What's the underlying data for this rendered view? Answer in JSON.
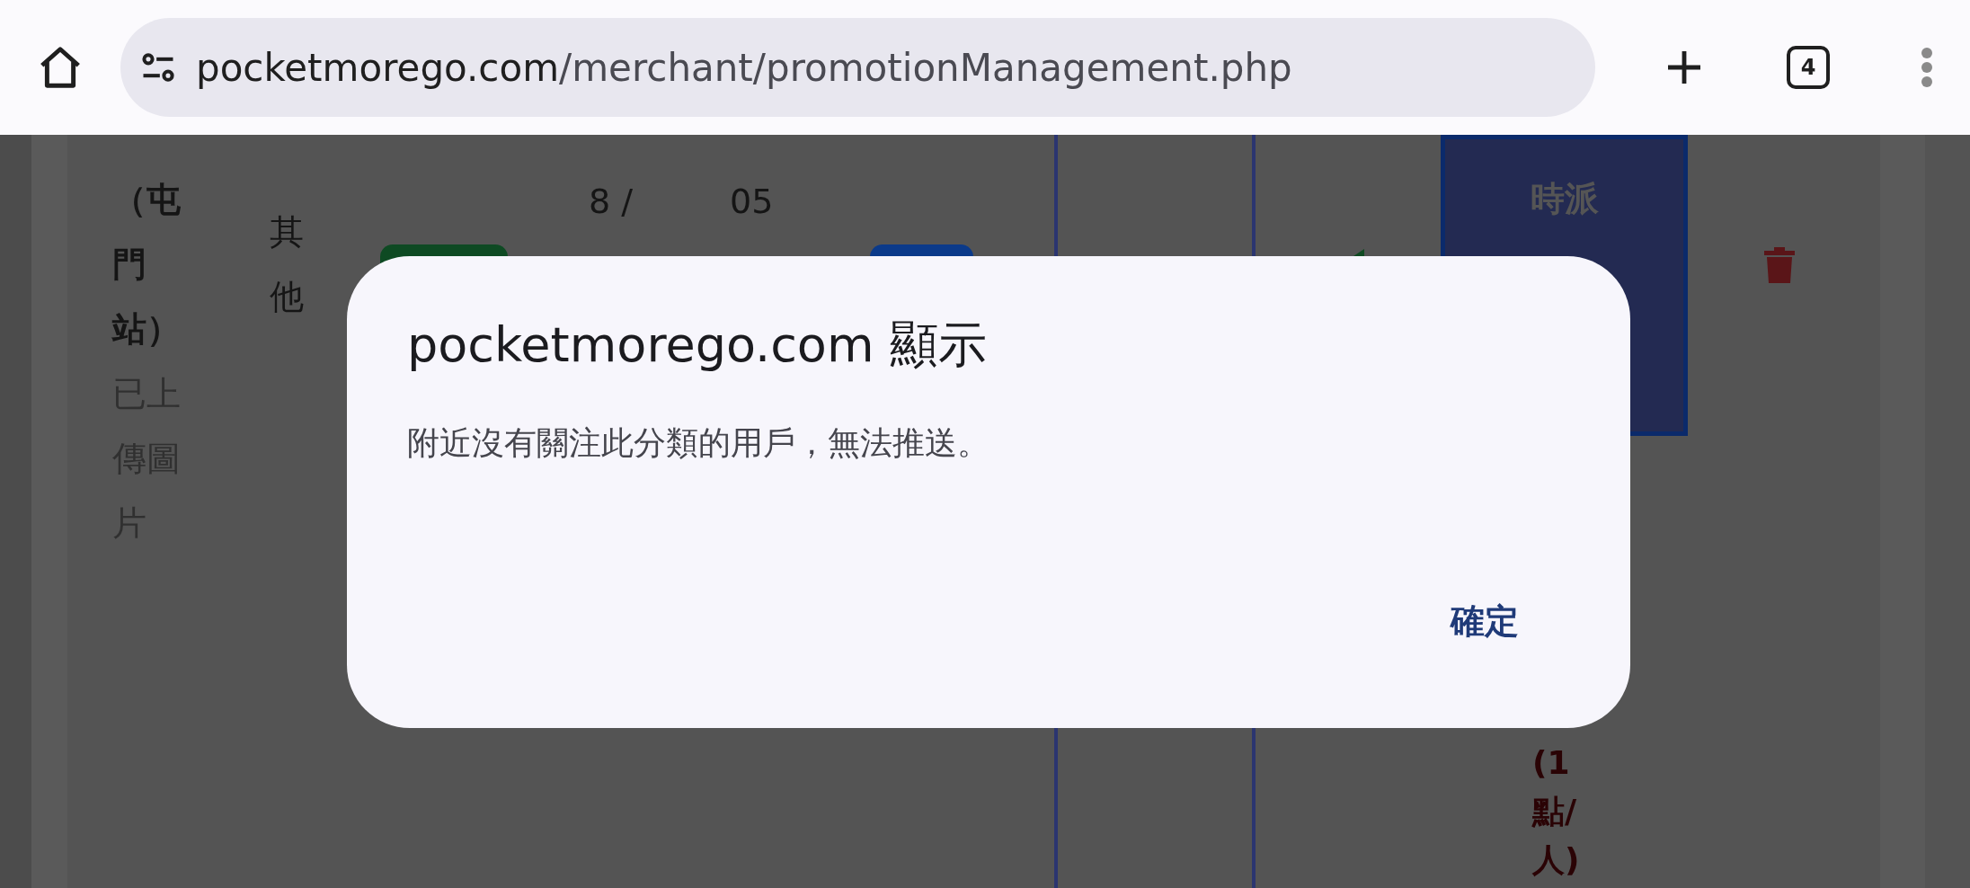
{
  "browser": {
    "url": {
      "host": "pocketmorego.com",
      "path": "/merchant/promotionManagement.php"
    },
    "tab_count": "4"
  },
  "page": {
    "row": {
      "name": "（屯門站）",
      "image_status": "已上傳圖片",
      "category": "其他",
      "column_4": "8 /",
      "column_5": "05",
      "column_9": "時派",
      "column_10": "(1點/人)"
    }
  },
  "dialog": {
    "title": "pocketmorego.com 顯示",
    "message": "附近沒有關注此分類的用戶，無法推送。",
    "buttons": [
      "確定"
    ]
  }
}
